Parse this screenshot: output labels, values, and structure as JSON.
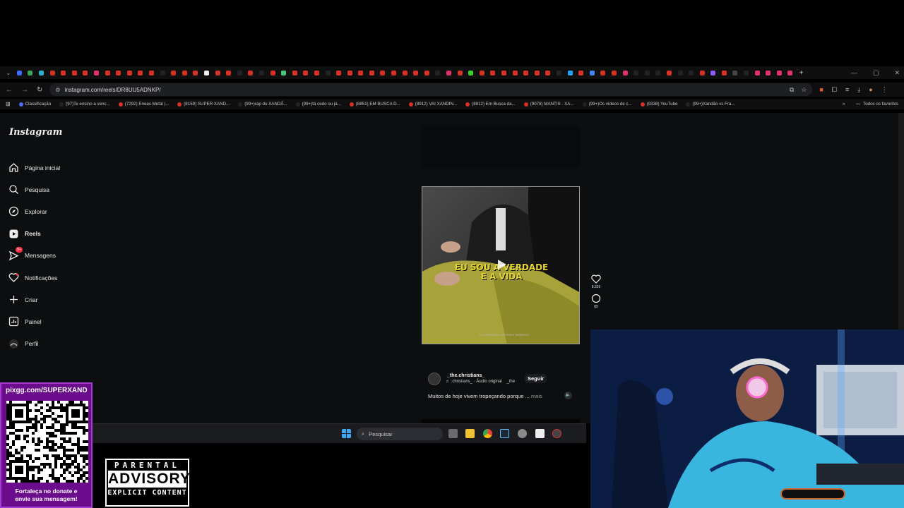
{
  "browser": {
    "url": "instagram.com/reels/DR8UU5ADNKP/",
    "tab_colors": [
      "#3d6bff",
      "#3fa35a",
      "#27b0c9",
      "#d93025",
      "#d93025",
      "#d93025",
      "#d93025",
      "#e1306c",
      "#d93025",
      "#d93025",
      "#d93025",
      "#d93025",
      "#d93025",
      "#222",
      "#d93025",
      "#d93025",
      "#d93025",
      "#eee",
      "#d93025",
      "#d93025",
      "#222",
      "#d93025",
      "#222",
      "#d93025",
      "#48c774",
      "#d93025",
      "#d93025",
      "#d93025",
      "#222",
      "#d93025",
      "#d93025",
      "#d93025",
      "#d93025",
      "#d93025",
      "#d93025",
      "#d93025",
      "#d93025",
      "#d93025",
      "#222",
      "#e1306c",
      "#d93025",
      "#3fcf2a",
      "#d93025",
      "#d93025",
      "#d93025",
      "#d93025",
      "#d93025",
      "#d93025",
      "#d93025",
      "#222",
      "#1da1f2",
      "#d93025",
      "#4285f4",
      "#d93025",
      "#d93025",
      "#e1306c",
      "#222",
      "#222",
      "#222",
      "#d93025",
      "#222",
      "#222",
      "#d93025",
      "#8a5cf6",
      "#d93025",
      "#444",
      "#222",
      "#e1306c",
      "#e1306c",
      "#e1306c",
      "#e1306c"
    ],
    "new_tab": "+",
    "bookmarks": [
      {
        "label": "Classificação",
        "color": "#4a6cf7"
      },
      {
        "label": "(97)Te ensino a venc...",
        "color": "#222"
      },
      {
        "label": "(7292) Eneas Metal |...",
        "color": "#d93025"
      },
      {
        "label": "(8159) SUPER XAND...",
        "color": "#d93025"
      },
      {
        "label": "(99+)rap do XANDÃ...",
        "color": "#222"
      },
      {
        "label": "(99+)tá cedo ou já...",
        "color": "#222"
      },
      {
        "label": "(8851) EM BUSCA D...",
        "color": "#d93025"
      },
      {
        "label": "(8912) VAI XANDIN...",
        "color": "#d93025"
      },
      {
        "label": "(8912) Em Busca da...",
        "color": "#d93025"
      },
      {
        "label": "(9078) MANTIS - XA...",
        "color": "#d93025"
      },
      {
        "label": "(99+)Os vídeos de c...",
        "color": "#222"
      },
      {
        "label": "(9338) YouTube",
        "color": "#d93025"
      },
      {
        "label": "(99+)Xandão vs Fra...",
        "color": "#222"
      }
    ],
    "all_bookmarks": "Todos os favoritos"
  },
  "instagram": {
    "logo": "Instagram",
    "nav": [
      {
        "label": "Página inicial",
        "icon": "home-icon"
      },
      {
        "label": "Pesquisa",
        "icon": "search-icon"
      },
      {
        "label": "Explorar",
        "icon": "compass-icon"
      },
      {
        "label": "Reels",
        "icon": "reels-icon"
      },
      {
        "label": "Mensagens",
        "icon": "messenger-icon",
        "badge": "9+"
      },
      {
        "label": "Notificações",
        "icon": "heart-icon"
      },
      {
        "label": "Criar",
        "icon": "plus-icon"
      },
      {
        "label": "Painel",
        "icon": "chart-icon"
      },
      {
        "label": "Perfil",
        "icon": "avatar-icon"
      }
    ],
    "reel": {
      "overlay_text_line1": "EU SOU A VERDADE",
      "overlay_text_line2": "E A VIDA",
      "watermark": "THE CHRISTIANS COPYRIGHT RESERVED",
      "likes": "8.339",
      "comments": "89",
      "username": "_the.christians_",
      "audio": "♬ .christians_ · Áudio original",
      "audio_suffix": "_the",
      "follow": "Seguir",
      "caption": "Muitos de hoje vivem tropeçando porque ...",
      "more": "mais"
    }
  },
  "taskbar": {
    "search_placeholder": "Pesquisar"
  },
  "overlay": {
    "pix_url": "pixgg.com/SUPERXAND",
    "pix_message_line1": "Fortaleça no donate e",
    "pix_message_line2": "envie sua mensagem!",
    "advisory_line1": "PARENTAL",
    "advisory_line2": "ADVISORY",
    "advisory_line3": "EXPLICIT CONTENT"
  }
}
